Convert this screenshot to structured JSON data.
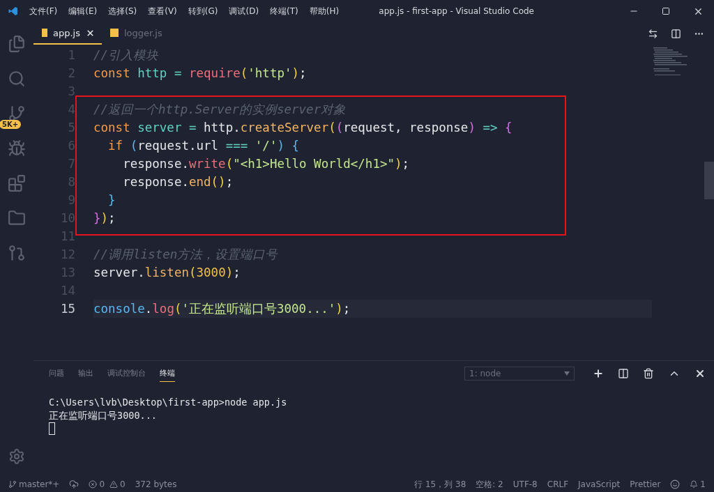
{
  "window": {
    "title": "app.js - first-app - Visual Studio Code"
  },
  "menu": [
    "文件(F)",
    "编辑(E)",
    "选择(S)",
    "查看(V)",
    "转到(G)",
    "调试(D)",
    "终端(T)",
    "帮助(H)"
  ],
  "activity": {
    "badge": "5K+"
  },
  "tabs": [
    {
      "label": "app.js",
      "selected": true
    },
    {
      "label": "logger.js",
      "selected": false
    }
  ],
  "editor": {
    "lines": [
      {
        "number": "1",
        "current": false,
        "tokens": [
          {
            "kind": "comment",
            "text": "//引入模块"
          }
        ]
      },
      {
        "number": "2",
        "current": false,
        "tokens": [
          {
            "kind": "keyword",
            "text": "const "
          },
          {
            "kind": "variable",
            "text": "http"
          },
          {
            "kind": "operator",
            "text": " = "
          },
          {
            "kind": "function",
            "text": "require"
          },
          {
            "kind": "bracket1",
            "text": "("
          },
          {
            "kind": "string",
            "text": "'http'"
          },
          {
            "kind": "bracket1",
            "text": ")"
          },
          {
            "kind": "plain",
            "text": ";"
          }
        ]
      },
      {
        "number": "3",
        "current": false
      },
      {
        "number": "4",
        "current": false,
        "tokens": [
          {
            "kind": "comment",
            "text": "//返回一个http.Server的实例server对象"
          }
        ]
      },
      {
        "number": "5",
        "current": false,
        "tokens": [
          {
            "kind": "keyword",
            "text": "const "
          },
          {
            "kind": "variable",
            "text": "server"
          },
          {
            "kind": "operator",
            "text": " = "
          },
          {
            "kind": "plain",
            "text": "http."
          },
          {
            "kind": "method",
            "text": "createServer"
          },
          {
            "kind": "bracket1",
            "text": "("
          },
          {
            "kind": "bracket2",
            "text": "("
          },
          {
            "kind": "plain",
            "text": "request, response"
          },
          {
            "kind": "bracket2",
            "text": ")"
          },
          {
            "kind": "operator",
            "text": " => "
          },
          {
            "kind": "bracket2",
            "text": "{"
          }
        ]
      },
      {
        "number": "6",
        "current": false,
        "tokens": [
          {
            "kind": "keyword2",
            "text": "  if "
          },
          {
            "kind": "bracket3",
            "text": "("
          },
          {
            "kind": "plain",
            "text": "request.url "
          },
          {
            "kind": "operator",
            "text": "==="
          },
          {
            "kind": "string",
            "text": " '/'"
          },
          {
            "kind": "bracket3",
            "text": ")"
          },
          {
            "kind": "bracket3",
            "text": " {"
          }
        ]
      },
      {
        "number": "7",
        "current": false,
        "tokens": [
          {
            "kind": "plain",
            "text": "    response."
          },
          {
            "kind": "function",
            "text": "write"
          },
          {
            "kind": "bracket1",
            "text": "("
          },
          {
            "kind": "string",
            "text": "\"<h1>Hello World</h1>\""
          },
          {
            "kind": "bracket1",
            "text": ")"
          },
          {
            "kind": "plain",
            "text": ";"
          }
        ]
      },
      {
        "number": "8",
        "current": false,
        "tokens": [
          {
            "kind": "plain",
            "text": "    response."
          },
          {
            "kind": "method",
            "text": "end"
          },
          {
            "kind": "bracket1",
            "text": "()"
          },
          {
            "kind": "plain",
            "text": ";"
          }
        ]
      },
      {
        "number": "9",
        "current": false,
        "tokens": [
          {
            "kind": "bracket3",
            "text": "  }"
          }
        ]
      },
      {
        "number": "10",
        "current": false,
        "tokens": [
          {
            "kind": "bracket2",
            "text": "}"
          },
          {
            "kind": "bracket1",
            "text": ")"
          },
          {
            "kind": "plain",
            "text": ";"
          }
        ]
      },
      {
        "number": "11",
        "current": false
      },
      {
        "number": "12",
        "current": false,
        "tokens": [
          {
            "kind": "comment",
            "text": "//调用listen方法，设置端口号"
          }
        ]
      },
      {
        "number": "13",
        "current": false,
        "tokens": [
          {
            "kind": "plain",
            "text": "server."
          },
          {
            "kind": "method",
            "text": "listen"
          },
          {
            "kind": "bracket1",
            "text": "("
          },
          {
            "kind": "number",
            "text": "3000"
          },
          {
            "kind": "bracket1",
            "text": ")"
          },
          {
            "kind": "plain",
            "text": ";"
          }
        ]
      },
      {
        "number": "14",
        "current": false
      },
      {
        "number": "15",
        "current": true,
        "tokens": [
          {
            "kind": "variable2",
            "text": "console"
          },
          {
            "kind": "plain",
            "text": "."
          },
          {
            "kind": "function",
            "text": "log"
          },
          {
            "kind": "bracket1",
            "text": "("
          },
          {
            "kind": "string",
            "text": "'正在监听端口号3000...'"
          },
          {
            "kind": "bracket1",
            "text": ")"
          },
          {
            "kind": "plain",
            "text": ";"
          }
        ]
      }
    ]
  },
  "panel": {
    "tabs": [
      {
        "label": "问题",
        "selected": false
      },
      {
        "label": "输出",
        "selected": false
      },
      {
        "label": "调试控制台",
        "selected": false
      },
      {
        "label": "终端",
        "selected": true
      }
    ],
    "terminal_select": "1: node",
    "terminal_lines": [
      "C:\\Users\\lvb\\Desktop\\first-app>node app.js",
      "正在监听端口号3000..."
    ]
  },
  "status_bar": {
    "branch": "master*+",
    "errors": "0",
    "warnings": "0",
    "size": "372 bytes",
    "position": "行 15，列 38",
    "spaces": "空格: 2",
    "encoding": "UTF-8",
    "eol": "CRLF",
    "language": "JavaScript",
    "formatter": "Prettier",
    "notifications": "1"
  }
}
